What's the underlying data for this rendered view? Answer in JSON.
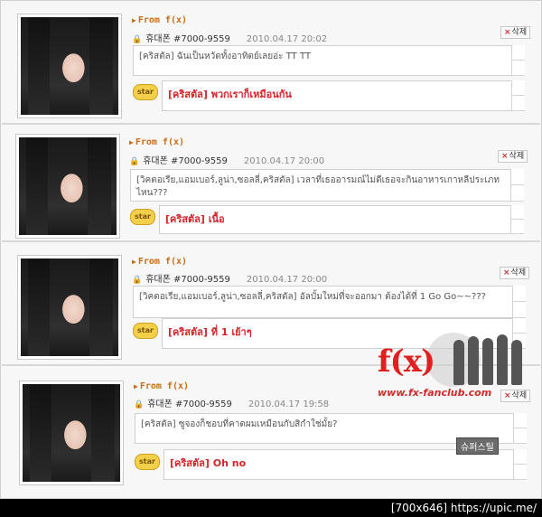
{
  "posts": [
    {
      "from_label": "From f(x)",
      "sender": "휴대폰 #7000-9559",
      "date": "2010.04.17 20:02",
      "delete_label": "삭제",
      "message": "[คริสตัล] ฉันเป็นหวัดทั้งอาทิตย์เลยอ่ะ TT TT",
      "star_label": "star",
      "reply": "[คริสตัล] พวกเราก็เหมือนกัน"
    },
    {
      "from_label": "From f(x)",
      "sender": "휴대폰 #7000-9559",
      "date": "2010.04.17 20:00",
      "delete_label": "삭제",
      "message": "[วิคตอเรีย,แอมเบอร์,ลูน่า,ซอลลี่,คริสตัล] เวลาที่เธออารมณ์ไม่ดีเธอจะกินอาหารเกาหลีประเภทไหน???",
      "star_label": "star",
      "reply": "[คริสตัล] เนื้อ"
    },
    {
      "from_label": "From f(x)",
      "sender": "휴대폰 #7000-9559",
      "date": "2010.04.17 20:00",
      "delete_label": "삭제",
      "message": "[วิคตอเรีย,แอมเบอร์,ลูน่า,ซอลลี่,คริสตัล] อัลบั้มใหม่ที่จะออกมา ต้องได้ที่ 1 Go Go~~???",
      "star_label": "star",
      "reply": "[คริสตัล] ที่ 1 เย้าๆ"
    },
    {
      "from_label": "From f(x)",
      "sender": "휴대폰 #7000-9559",
      "date": "2010.04.17 19:58",
      "delete_label": "삭제",
      "message": "[คริสตัล] ซูจองก็ชอบที่คาดผมเหมือนกับสิกำใช่มั้ย?",
      "star_label": "star",
      "reply": "[คริสตัล] Oh no"
    }
  ],
  "watermark": {
    "logo": "f(x)",
    "url": "www.fx-fanclub.com"
  },
  "stamp": "슈퍼스틸",
  "footer": "[700x646] https://upic.me/"
}
